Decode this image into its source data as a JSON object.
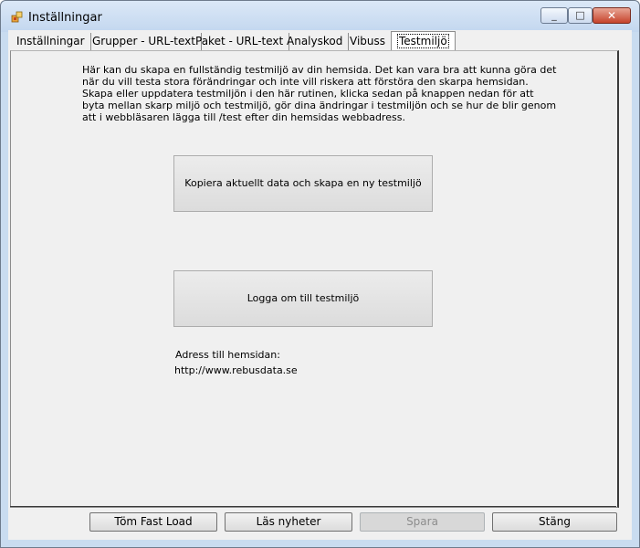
{
  "window": {
    "title": "Inställningar",
    "close_glyph": "✕",
    "min_glyph": "_",
    "max_glyph": "□"
  },
  "tabs": [
    {
      "label": "Inställningar"
    },
    {
      "label": "Grupper - URL-text"
    },
    {
      "label": "Paket - URL-text"
    },
    {
      "label": "Analyskod"
    },
    {
      "label": "Vibuss"
    },
    {
      "label": "Testmiljö",
      "active": true
    }
  ],
  "panel": {
    "description": "Här kan du skapa en fullständig testmiljö av din hemsida. Det kan vara bra att kunna göra det när du vill testa stora förändringar och inte vill riskera att förstöra den skarpa hemsidan. Skapa eller uppdatera testmiljön i den här rutinen, klicka sedan på knappen nedan för att byta mellan skarp miljö och testmiljö, gör dina ändringar i testmiljön och se hur de blir genom att i webbläsaren lägga till /test efter din hemsidas webbadress.",
    "copy_button": "Kopiera aktuellt data och skapa en ny testmiljö",
    "login_button": "Logga om till testmiljö",
    "address_label": "Adress till hemsidan:",
    "address_value": "http://www.rebusdata.se"
  },
  "footer": {
    "clear_cache": "Töm Fast Load",
    "read_news": "Läs nyheter",
    "save": "Spara",
    "close": "Stäng"
  },
  "icons": {
    "app": "settings-app-icon"
  }
}
